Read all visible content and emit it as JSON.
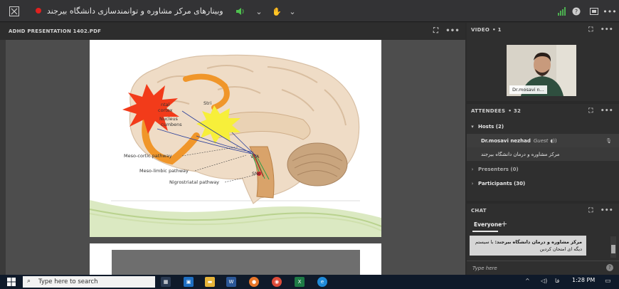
{
  "topbar": {
    "title": "وبینارهای مرکز مشاوره و توانمندسازی دانشگاه بیرجند",
    "icons": [
      "resize-icon",
      "record-icon",
      "speaker-icon",
      "chevron-down-icon",
      "hand-icon",
      "chevron-down-icon",
      "signal-bars-icon",
      "help-icon",
      "screen-icon",
      "more-icon"
    ]
  },
  "share": {
    "title": "ADHD PRESENTATION 1402.PDF"
  },
  "slide": {
    "labels": {
      "frontal": "ntal",
      "cortex": "cortex",
      "nucleus": "Nucleus",
      "accumbens": "cumbens",
      "striatum": "Stri",
      "vta": "VTA",
      "snc": "SNc",
      "mesocortic": "Meso-cortic pathway",
      "mesolimbic": "Meso-limbic pathway",
      "nigrostriatal": "Nigrostriatal pathway"
    }
  },
  "video": {
    "title": "VIDEO",
    "count": "• 1",
    "label": "Dr.mosavi n..."
  },
  "attendees": {
    "title": "ATTENDEES",
    "count": "• 32",
    "hosts": "Hosts (2)",
    "host1_name": "Dr.mosavi nezhad",
    "host1_role": "Guest",
    "host2_name": "مرکز مشاوره و درمان دانشگاه بیرجند",
    "presenters": "Presenters (0)",
    "participants": "Participants (30)"
  },
  "chat": {
    "title": "CHAT",
    "tab": "Everyone",
    "msg_sender": "مرکز مشاوره و درمان دانشگاه بیرجند:",
    "msg_text_1": "با سیستم",
    "msg_text_2": "دیگه ای امتحان کردین",
    "input_placeholder": "Type here"
  },
  "taskbar": {
    "search_placeholder": "Type here to search",
    "time": "1:28 PM",
    "lang": "فا"
  },
  "colors": {
    "accent_red": "#e0211f",
    "signal_green": "#4caf50",
    "slide_green_wave": "#c7dca0"
  }
}
